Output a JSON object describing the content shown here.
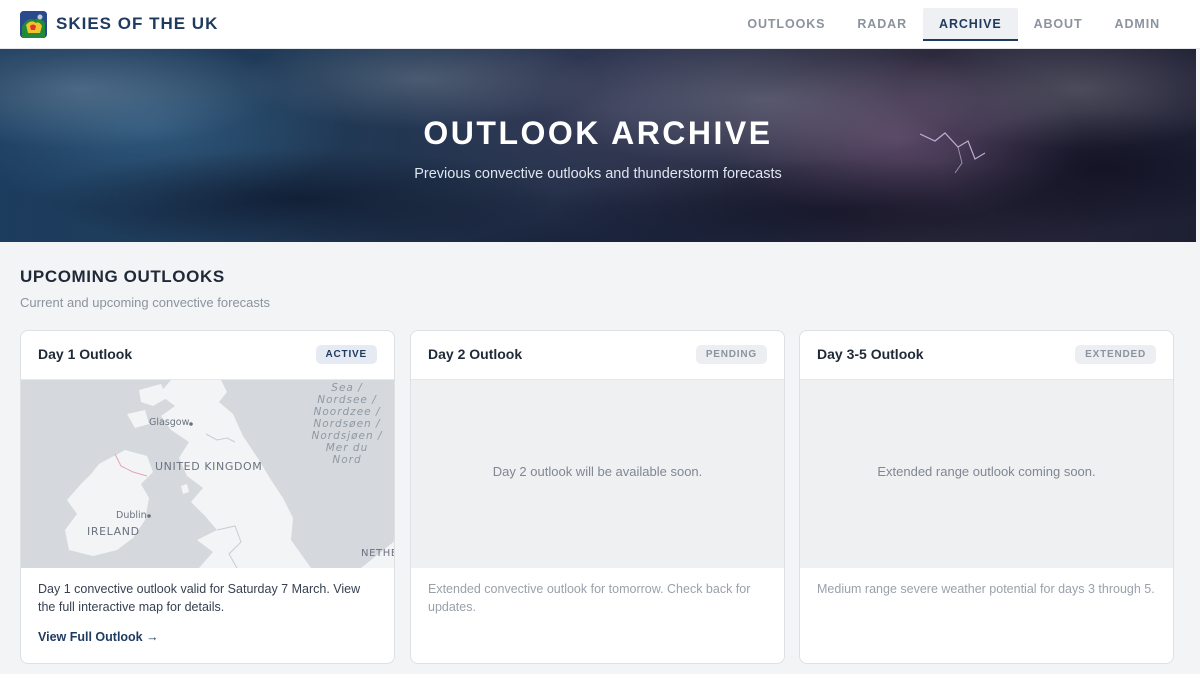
{
  "app": {
    "title": "SKIES OF THE UK"
  },
  "nav": {
    "items": [
      {
        "label": "OUTLOOKS",
        "active": false
      },
      {
        "label": "RADAR",
        "active": false
      },
      {
        "label": "ARCHIVE",
        "active": true
      },
      {
        "label": "ABOUT",
        "active": false
      },
      {
        "label": "ADMIN",
        "active": false
      }
    ]
  },
  "hero": {
    "title": "OUTLOOK ARCHIVE",
    "subtitle": "Previous convective outlooks and thunderstorm forecasts"
  },
  "section": {
    "title": "UPCOMING OUTLOOKS",
    "subtitle": "Current and upcoming convective forecasts"
  },
  "cards": [
    {
      "title": "Day 1 Outlook",
      "badge": "ACTIVE",
      "description": "Day 1 convective outlook valid for Saturday 7 March. View the full interactive map for details.",
      "link": "View Full Outlook →",
      "map": {
        "labels": {
          "glasgow": "Glasgow",
          "uk": "UNITED KINGDOM",
          "dublin": "Dublin",
          "ireland": "IRELAND",
          "netherlands_partial": "NETHE",
          "sea_lines": [
            "Sea /",
            "Nordsee /",
            "Noordzee /",
            "Nordsøen /",
            "Nordsjøen /",
            "Mer du",
            "Nord"
          ]
        }
      }
    },
    {
      "title": "Day 2 Outlook",
      "badge": "PENDING",
      "placeholder": "Day 2 outlook will be available soon.",
      "description": "Extended convective outlook for tomorrow. Check back for updates."
    },
    {
      "title": "Day 3-5 Outlook",
      "badge": "EXTENDED",
      "placeholder": "Extended range outlook coming soon.",
      "description": "Medium range severe weather potential for days 3 through 5."
    }
  ],
  "colors": {
    "brand": "#1e3a5f",
    "background": "#f3f4f6",
    "muted_text": "#8b939e"
  }
}
